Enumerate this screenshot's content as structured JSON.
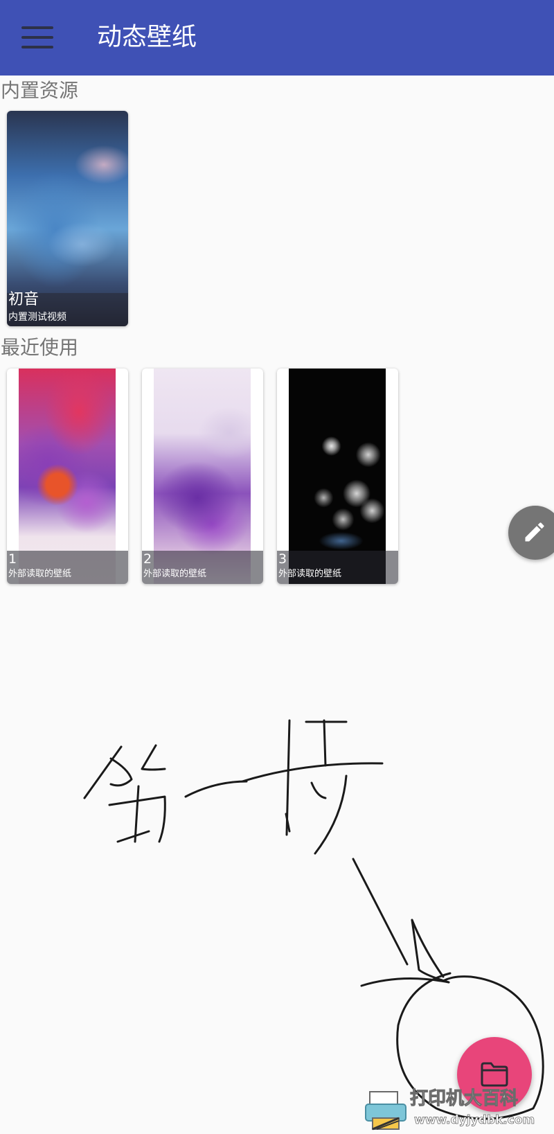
{
  "app_bar": {
    "title": "动态壁纸",
    "background_color": "#3f51b5",
    "menu_icon": "hamburger-menu-icon"
  },
  "builtin_section": {
    "heading": "内置资源",
    "items": [
      {
        "name": "初音",
        "description": "内置测试视频"
      }
    ]
  },
  "recent_section": {
    "heading": "最近使用",
    "items": [
      {
        "name": "1",
        "description": "外部读取的壁纸"
      },
      {
        "name": "2",
        "description": "外部读取的壁纸"
      },
      {
        "name": "3",
        "description": "外部读取的壁纸"
      }
    ]
  },
  "fabs": {
    "edit_icon": "pencil-icon",
    "edit_color": "#757575",
    "folder_icon": "folder-icon",
    "folder_color": "#e8457a"
  },
  "annotation": {
    "handwriting_text": "第一步"
  },
  "watermark": {
    "text": "打印机大百科",
    "url_text": "www.dyjydbk.com"
  }
}
